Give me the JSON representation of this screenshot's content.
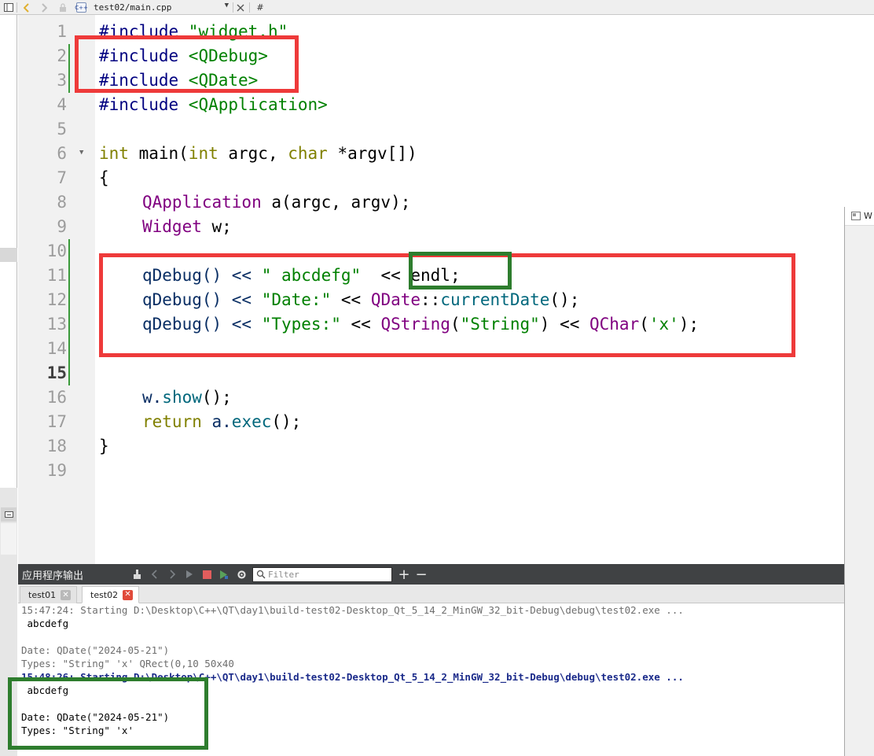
{
  "toolbar": {
    "file_name": "test02/main.cpp",
    "file_type_badge": "C++",
    "hash_label": "#",
    "icons": [
      "toggle-sidebar-icon",
      "back-arrow-icon",
      "forward-arrow-icon",
      "lock-icon",
      "file-icon",
      "dropdown-arrow-icon",
      "split-icon",
      "close-icon"
    ]
  },
  "editor": {
    "line_numbers": [
      "1",
      "2",
      "3",
      "4",
      "5",
      "6",
      "7",
      "8",
      "9",
      "10",
      "11",
      "12",
      "13",
      "14",
      "15",
      "16",
      "17",
      "18",
      "19"
    ],
    "current_line": "15",
    "code": {
      "l1_pp": "#include ",
      "l1_inc": "\"widget.h\"",
      "l2_pp": "#include ",
      "l2_inc": "<QDebug>",
      "l3_pp": "#include ",
      "l3_inc": "<QDate>",
      "l4_pp": "#include ",
      "l4_inc": "<QApplication>",
      "l6_kw1": "int",
      "l6_a": " main(",
      "l6_kw2": "int",
      "l6_b": " argc, ",
      "l6_kw3": "char",
      "l6_c": " *argv[])",
      "l7": "{",
      "l8_ty": "QApplication",
      "l8_rest": " a(argc, argv);",
      "l9_ty": "Widget",
      "l9_rest": " w;",
      "l11_a": "qDebug() << ",
      "l11_str": "\" abcdefg\"",
      "l11_b": "  << endl;",
      "l12_a": "qDebug() << ",
      "l12_str": "\"Date:\"",
      "l12_b": " << ",
      "l12_ty": "QDate",
      "l12_c": "::",
      "l12_fn": "currentDate",
      "l12_d": "();",
      "l13_a": "qDebug() << ",
      "l13_str": "\"Types:\"",
      "l13_b": " << ",
      "l13_ty1": "QString",
      "l13_c": "(",
      "l13_str2": "\"String\"",
      "l13_d": ") << ",
      "l13_ty2": "QChar",
      "l13_e": "(",
      "l13_str3": "'x'",
      "l13_f": ");",
      "l16_a": "w.",
      "l16_fn": "show",
      "l16_b": "();",
      "l17_kw": "return",
      "l17_a": " a.",
      "l17_fn": "exec",
      "l17_b": "();",
      "l18": "}"
    }
  },
  "right_window": {
    "title_fragment": "W"
  },
  "output_pane": {
    "title": "应用程序输出",
    "filter_placeholder": "Filter",
    "tabs": [
      {
        "label": "test01",
        "active": false
      },
      {
        "label": "test02",
        "active": true
      }
    ],
    "lines": [
      {
        "text": "15:47:24: Starting D:\\Desktop\\C++\\QT\\day1\\build-test02-Desktop_Qt_5_14_2_MinGW_32_bit-Debug\\debug\\test02.exe ...",
        "kind": "sys"
      },
      {
        "text": " abcdefg",
        "kind": "normal"
      },
      {
        "text": "",
        "kind": "normal"
      },
      {
        "text": "Date: QDate(\"2024-05-21\")",
        "kind": "normal"
      },
      {
        "text": "Types: \"String\" 'x' QRect(0,10 50x40",
        "kind": "sys"
      },
      {
        "text": "15:48:26: Starting D:\\Desktop\\C++\\QT\\day1\\build-test02-Desktop_Qt_5_14_2_MinGW_32_bit-Debug\\debug\\test02.exe ...",
        "kind": "sys-bold"
      },
      {
        "text": " abcdefg",
        "kind": "normal"
      },
      {
        "text": "",
        "kind": "normal"
      },
      {
        "text": "Date: QDate(\"2024-05-21\")",
        "kind": "normal"
      },
      {
        "text": "Types: \"String\" 'x'",
        "kind": "normal"
      }
    ]
  },
  "colors": {
    "annotation_red": "#ee3a3a",
    "annotation_green": "#2e7d2e",
    "preprocessor": "#000080",
    "string": "#008000",
    "keyword": "#808000",
    "type": "#800080"
  }
}
